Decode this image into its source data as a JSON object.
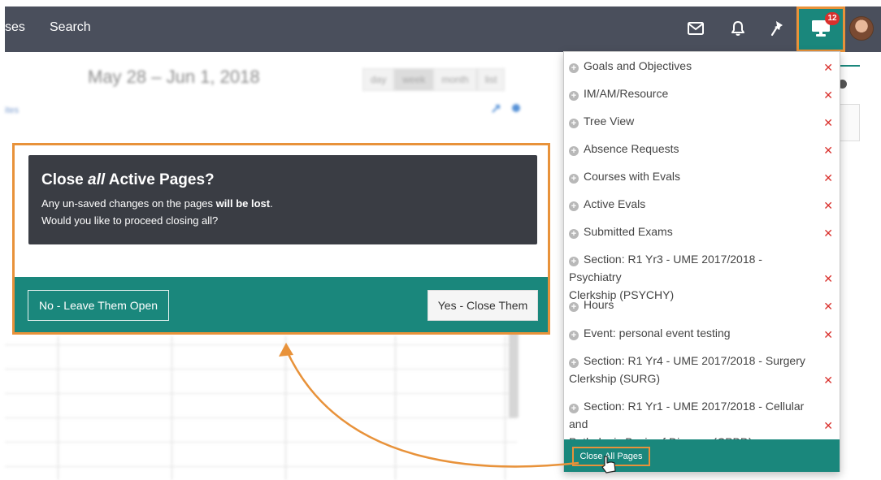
{
  "topbar": {
    "nav_partial": "ses",
    "search_label": "Search",
    "notification_count": "12"
  },
  "background": {
    "calendar_title": "May 28 – Jun 1, 2018",
    "views": [
      "day",
      "week",
      "month",
      "list"
    ],
    "active_view": "week",
    "sidebar_fragment": "ites"
  },
  "modal": {
    "title_pre": "Close ",
    "title_em": "all",
    "title_post": " Active Pages?",
    "message_pre": "Any un-saved changes on the pages ",
    "message_bold": "will be lost",
    "message_post": ".",
    "message_line2": "Would you like to proceed closing all?",
    "no_button": "No - Leave Them Open",
    "yes_button": "Yes - Close Them"
  },
  "dropdown": {
    "items": [
      {
        "line1": "Goals and Objectives",
        "line2": ""
      },
      {
        "line1": "IM/AM/Resource",
        "line2": ""
      },
      {
        "line1": "Tree View",
        "line2": ""
      },
      {
        "line1": "Absence Requests",
        "line2": ""
      },
      {
        "line1": "Courses with Evals",
        "line2": ""
      },
      {
        "line1": "Active Evals",
        "line2": ""
      },
      {
        "line1": "Submitted Exams",
        "line2": ""
      },
      {
        "line1": "Section: R1 Yr3 - UME 2017/2018 - Psychiatry",
        "line2": "Clerkship (PSYCHY)"
      },
      {
        "line1": "Hours",
        "line2": ""
      },
      {
        "line1": "Event: personal event testing",
        "line2": ""
      },
      {
        "line1": "Section: R1 Yr4 - UME 2017/2018 - Surgery",
        "line2": "Clerkship (SURG)"
      },
      {
        "line1": "Section: R1 Yr1 - UME 2017/2018 - Cellular and",
        "line2": "Pathologic Basis of Disease (CPBD)"
      }
    ],
    "close_glyph": "✕",
    "close_all_label": "Close All Pages"
  },
  "colors": {
    "teal": "#1a877c",
    "highlight_orange": "#e8923a",
    "topbar": "#4a4f5c",
    "modal_dark": "#3a3d44",
    "close_red": "#d9302c"
  }
}
